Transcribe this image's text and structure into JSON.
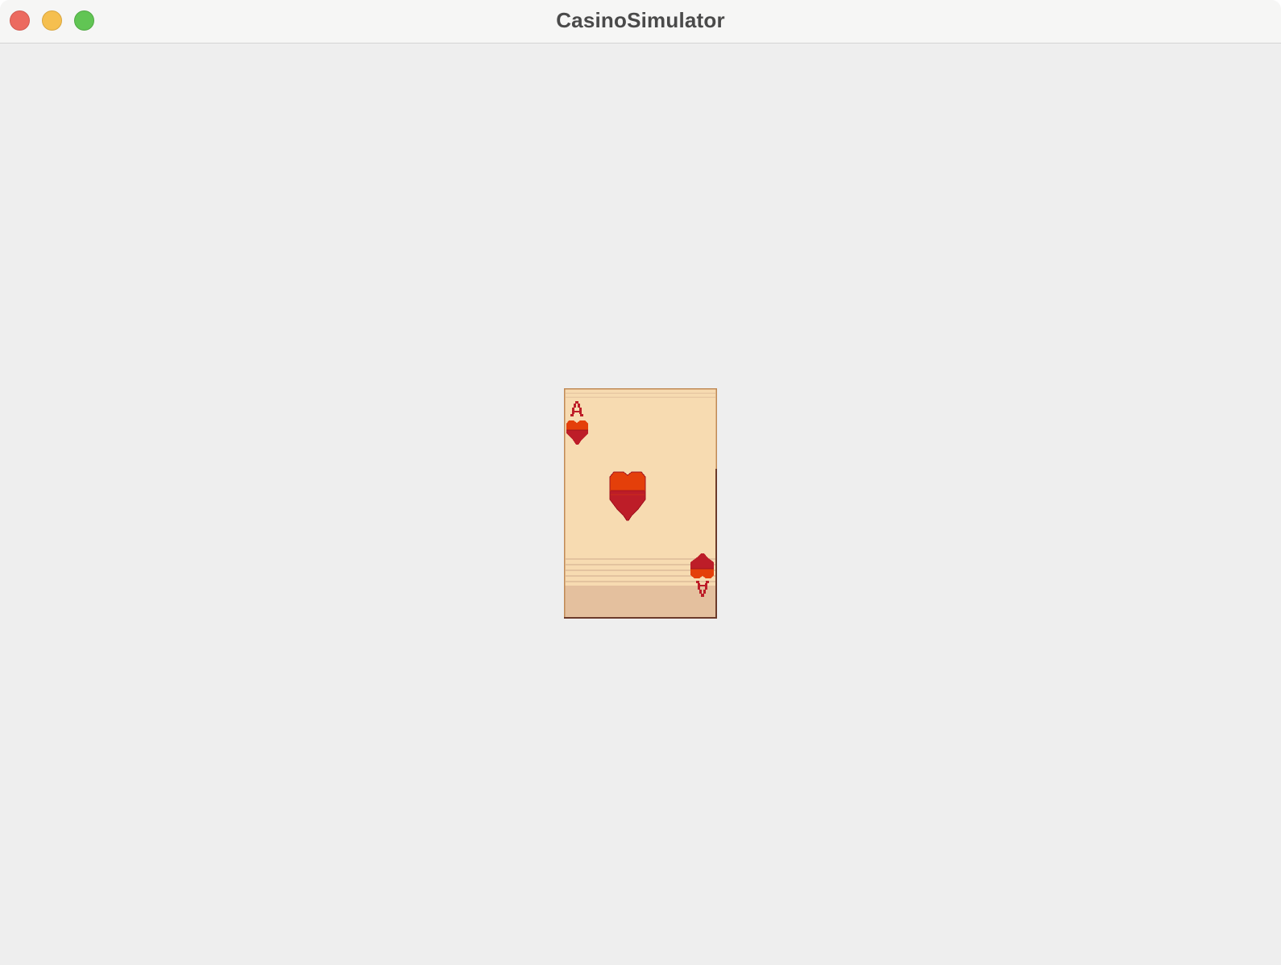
{
  "window": {
    "title": "CasinoSimulator"
  },
  "card": {
    "rank": "A",
    "suit": "hearts",
    "colors": {
      "face": "#f7dbb1",
      "bottom_band": "#e4c09e",
      "border": "#b37745",
      "suit_top": "#e43f0a",
      "suit_bottom": "#bd1d28"
    }
  }
}
